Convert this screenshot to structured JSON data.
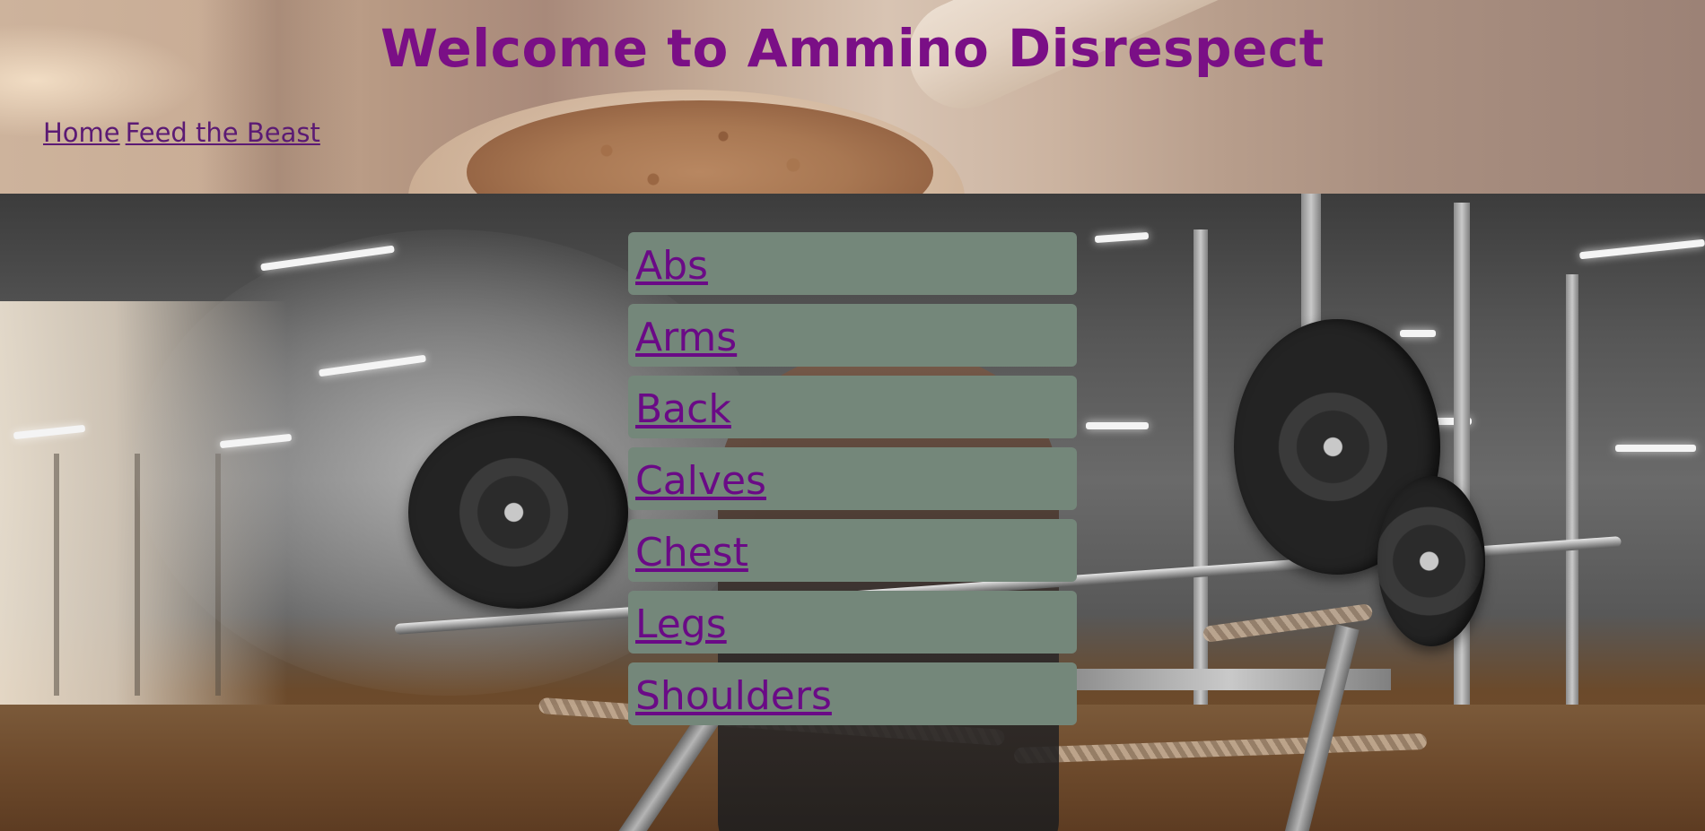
{
  "header": {
    "title": "Welcome to Ammino Disrespect",
    "nav": [
      {
        "label": "Home"
      },
      {
        "label": "Feed the Beast"
      }
    ]
  },
  "main": {
    "categories": [
      {
        "label": "Abs"
      },
      {
        "label": "Arms"
      },
      {
        "label": "Back"
      },
      {
        "label": "Calves"
      },
      {
        "label": "Chest"
      },
      {
        "label": "Legs"
      },
      {
        "label": "Shoulders"
      }
    ]
  },
  "colors": {
    "title": "#7a0f86",
    "link": "#6a0a86",
    "menu_item_bg": "#74877a"
  }
}
